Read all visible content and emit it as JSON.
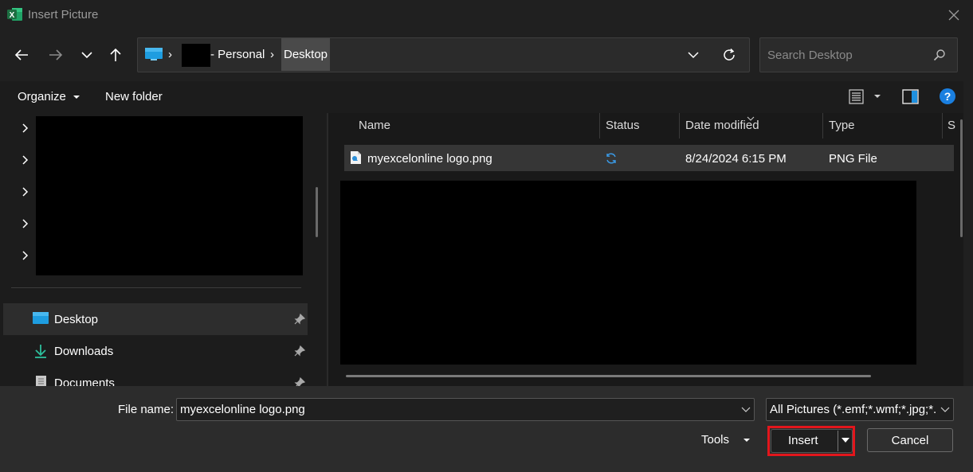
{
  "window": {
    "title": "Insert Picture",
    "app_icon": "excel-icon",
    "close_icon": "close-icon"
  },
  "nav": {
    "back_icon": "arrow-left-icon",
    "forward_icon": "arrow-right-icon",
    "recent_icon": "chevron-down-icon",
    "up_icon": "arrow-up-icon"
  },
  "address": {
    "separator": "›",
    "crumbs": [
      "- Personal",
      "Desktop"
    ],
    "dropdown_icon": "chevron-down-icon",
    "refresh_icon": "refresh-icon"
  },
  "search": {
    "placeholder": "Search Desktop",
    "icon": "search-icon"
  },
  "commands": {
    "organize": "Organize",
    "new_folder": "New folder",
    "view_icon": "list-view-icon",
    "preview_icon": "preview-pane-icon",
    "help_icon": "help-icon",
    "help_glyph": "?"
  },
  "sidebar": {
    "expander_icon": "chevron-right-icon",
    "quick_access": [
      {
        "label": "Desktop",
        "icon": "desktop-folder-icon",
        "pinned": true,
        "selected": true
      },
      {
        "label": "Downloads",
        "icon": "download-icon",
        "pinned": true,
        "selected": false
      },
      {
        "label": "Documents",
        "icon": "documents-icon",
        "pinned": true,
        "selected": false
      }
    ]
  },
  "file_list": {
    "columns": [
      "Name",
      "Status",
      "Date modified",
      "Type",
      "S"
    ],
    "rows": [
      {
        "name": "myexcelonline logo.png",
        "status_icon": "sync-icon",
        "date_modified": "8/24/2024 6:15 PM",
        "type": "PNG File"
      }
    ]
  },
  "footer": {
    "file_name_label": "File name:",
    "file_name_value": "myexcelonline logo.png",
    "filter_value": "All Pictures (*.emf;*.wmf;*.jpg;*.j",
    "tools_label": "Tools",
    "insert_label": "Insert",
    "cancel_label": "Cancel"
  },
  "colors": {
    "accent": "#0078d4",
    "highlight": "#e3161c",
    "excel_green": "#1d6f42"
  }
}
